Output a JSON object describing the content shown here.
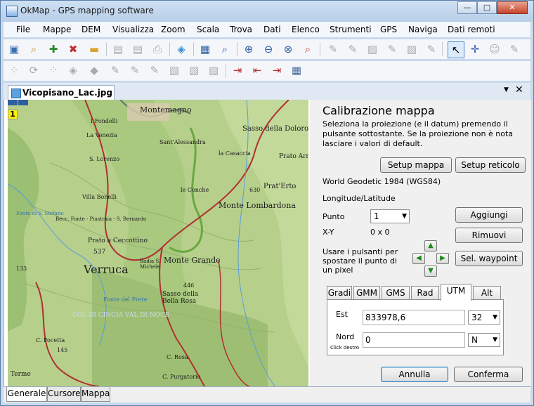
{
  "window": {
    "title": "OkMap - GPS mapping software",
    "controls": {
      "minimize": "—",
      "maximize": "□",
      "close": "✕"
    }
  },
  "menu": [
    "File",
    "Mappe",
    "DEM",
    "Visualizza",
    "Zoom",
    "Scala",
    "Trova",
    "Dati",
    "Elenco",
    "Strumenti",
    "GPS",
    "Naviga",
    "Dati remoti"
  ],
  "document_tab": {
    "label": "Vicopisano_Lac.jpg"
  },
  "map": {
    "marker": "1",
    "labels": {
      "montemagno": "Montemagno",
      "sasso_dolorosa": "Sasso della Doloros",
      "fondelli": "I Fondelli",
      "la_venezia": "La Venezia",
      "santalessandra": "Sant'Alessandra",
      "la_casaccia": "la Casaccia",
      "prato_arrez": "Prato Arre",
      "lorenzo": "S. Lorenzo",
      "erto": "Prat'Erto",
      "conche": "le Conche",
      "monte_lombardona": "Monte Lombardona",
      "villa_bonelli": "Villa Bonelli",
      "fonte_stefano": "Fonte di S. Stefano",
      "bernardo": "Becc. Fonte - Piastraia - S. Bernardo",
      "prato_ceccottino": "Prato a Ceccottino",
      "verruca": "Verruca",
      "monte_grande": "Monte Grande",
      "badia": "Badia S. Michele",
      "bella_rosa": "Sasso della Bella Rosa",
      "col_di_cincia": "COL DI CINCIA   VAL DI NOCE",
      "fonte_prete": "Fonte del Prete",
      "focetta": "C. Focetta",
      "rosa": "C. Rosa",
      "purgatorio": "C. Purgatorio",
      "terme": "Terme",
      "elev_537": "537",
      "elev_446": "446",
      "elev_630": "630",
      "elev_145": "145",
      "elev_133": "133"
    }
  },
  "panel": {
    "heading": "Calibrazione mappa",
    "description": "Seleziona la proiezione (e il datum) premendo il pulsante sottostante. Se la proiezione non è nota lasciare i valori di default.",
    "setup_map_button": "Setup mappa",
    "setup_grid_button": "Setup reticolo",
    "datum": "World Geodetic 1984 (WGS84)",
    "coordinate_system": "Longitude/Latitude",
    "point_label": "Punto",
    "point_value": "1",
    "xy_label": "X-Y",
    "xy_value": "0 x 0",
    "add_button": "Aggiungi",
    "remove_button": "Rimuovi",
    "move_hint": "Usare i pulsanti per spostare il punto di un pixel",
    "waypoint_button": "Sel. waypoint",
    "coord_tabs": [
      "Gradi",
      "GMM",
      "GMS",
      "Rad",
      "UTM",
      "Alt"
    ],
    "active_coord_tab": "UTM",
    "east_label": "Est",
    "east_value": "833978,6",
    "zone_value": "32",
    "north_label": "Nord",
    "north_value": "0",
    "hemisphere_value": "N",
    "right_click_hint": "Click destro",
    "cancel_button": "Annulla",
    "confirm_button": "Conferma"
  },
  "bottom_tabs": [
    "Generale",
    "Cursore",
    "Mappa"
  ],
  "colors": {
    "title_bar": "#c9d9ec",
    "map_green": "#b6d08c",
    "map_dark_green": "#8fb36b",
    "road_red": "#b03030",
    "river_blue": "#5a9bd8",
    "panel_bg": "#f0f0f0",
    "button_focus": "#3c7fb1"
  },
  "icons": [
    "open-map-icon",
    "search-icon",
    "add-map-icon",
    "remove-map-icon",
    "folder-icon",
    "save-icon",
    "save-as-icon",
    "print-icon",
    "gps-icon",
    "info-icon",
    "find-icon",
    "zoom-in-icon",
    "zoom-out-icon",
    "zoom-fit-icon",
    "zoom-one-to-one-icon",
    "edit-icon",
    "select-icon",
    "pointer-icon",
    "crosshair-icon"
  ]
}
